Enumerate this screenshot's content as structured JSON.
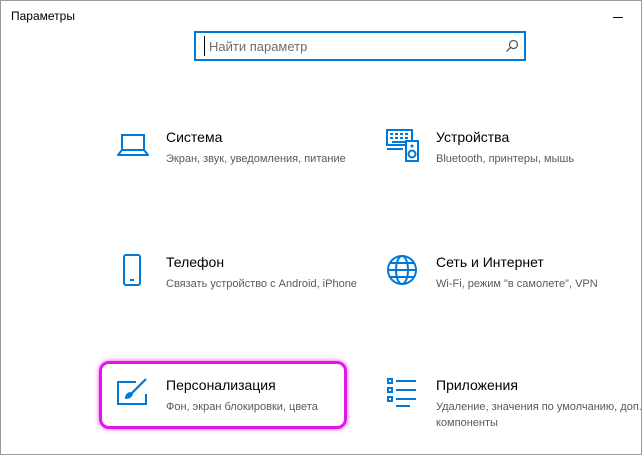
{
  "window": {
    "title": "Параметры"
  },
  "search": {
    "placeholder": "Найти параметр",
    "value": ""
  },
  "accent_color": "#0078d7",
  "highlight_color": "#e414e6",
  "tiles": [
    {
      "title": "Система",
      "description": "Экран, звук, уведомления, питание",
      "icon": "laptop-icon"
    },
    {
      "title": "Устройства",
      "description": "Bluetooth, принтеры, мышь",
      "icon": "keyboard-speaker-icon"
    },
    {
      "title": "Телефон",
      "description": "Связать устройство с Android, iPhone",
      "icon": "phone-icon"
    },
    {
      "title": "Сеть и Интернет",
      "description": "Wi-Fi, режим \"в самолете\", VPN",
      "icon": "globe-icon"
    },
    {
      "title": "Персонализация",
      "description": "Фон, экран блокировки, цвета",
      "icon": "paint-brush-icon",
      "highlighted": true
    },
    {
      "title": "Приложения",
      "description": "Удаление, значения по умолчанию, доп. компоненты",
      "icon": "apps-list-icon"
    }
  ]
}
